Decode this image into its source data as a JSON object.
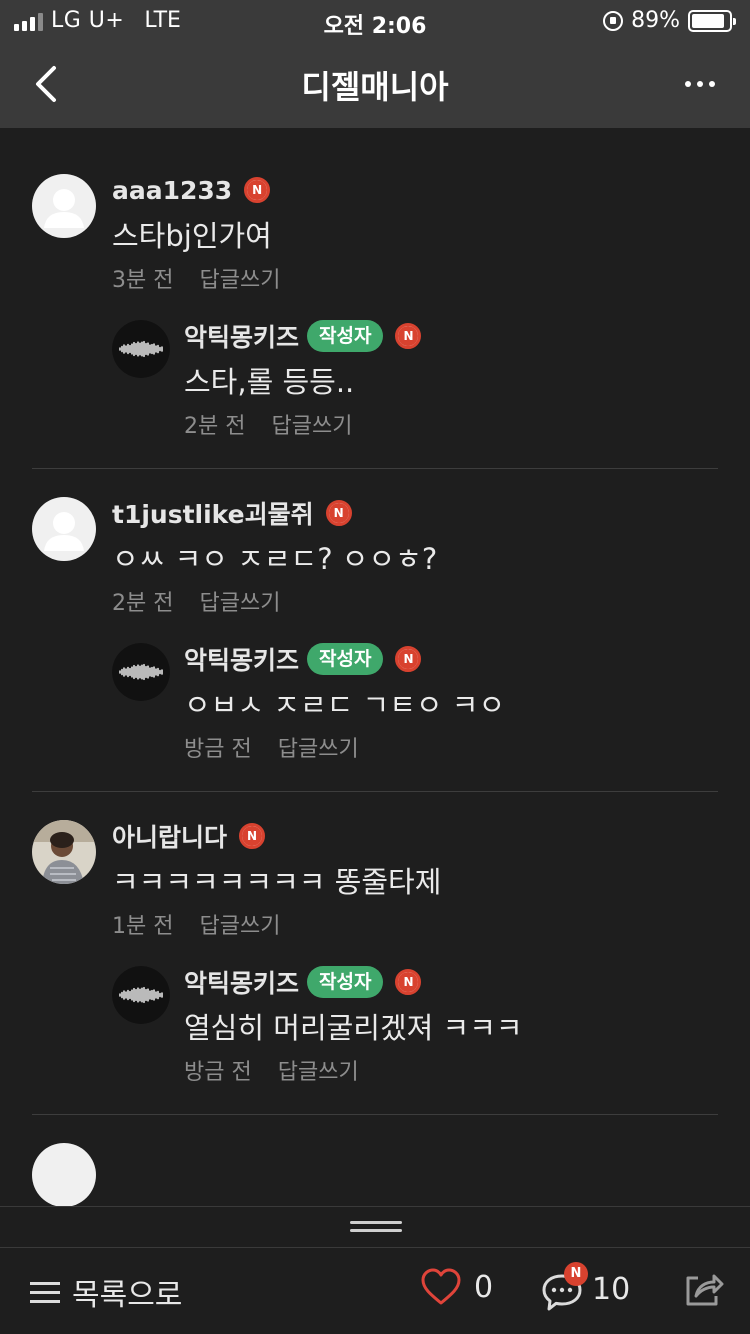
{
  "status_bar": {
    "carrier": "LG U+",
    "network": "LTE",
    "time": "오전 2:06",
    "battery": "89%",
    "battery_level": 0.89
  },
  "header": {
    "title": "디젤매니아"
  },
  "comments": [
    {
      "nick": "aaa1233",
      "badge": "N",
      "text": "스타bj인가여",
      "time": "3분 전",
      "reply_label": "답글쓰기",
      "reply": {
        "nick": "악틱몽키즈",
        "author_badge": "작성자",
        "badge": "N",
        "text": "스타,롤 등등..",
        "time": "2분 전",
        "reply_label": "답글쓰기"
      }
    },
    {
      "nick": "t1justlike괴물쥐",
      "badge": "N",
      "text": "ㅇㅆ ㅋㅇ ㅈㄹㄷ? ㅇㅇㅎ?",
      "time": "2분 전",
      "reply_label": "답글쓰기",
      "reply": {
        "nick": "악틱몽키즈",
        "author_badge": "작성자",
        "badge": "N",
        "text": "ㅇㅂㅅ ㅈㄹㄷ ㄱㅌㅇ ㅋㅇ",
        "time": "방금 전",
        "reply_label": "답글쓰기"
      }
    },
    {
      "nick": "아니랍니다",
      "badge": "N",
      "text": "ㅋㅋㅋㅋㅋㅋㅋㅋ 똥줄타제",
      "time": "1분 전",
      "reply_label": "답글쓰기",
      "reply": {
        "nick": "악틱몽키즈",
        "author_badge": "작성자",
        "badge": "N",
        "text": "열심히 머리굴리겠져 ㅋㅋㅋ",
        "time": "방금 전",
        "reply_label": "답글쓰기"
      }
    }
  ],
  "bottom_bar": {
    "list_label": "목록으로",
    "like_count": "0",
    "comment_count": "10",
    "comment_badge": "N"
  }
}
